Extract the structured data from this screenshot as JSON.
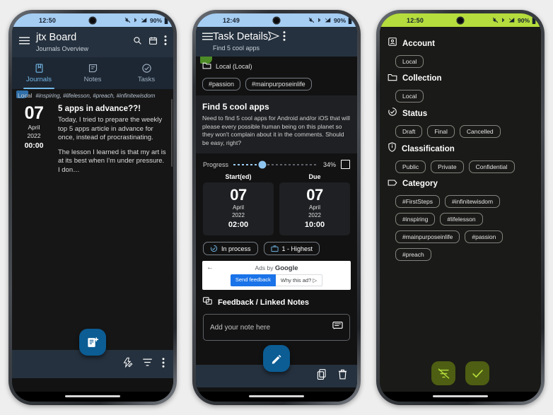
{
  "phone1": {
    "statusbar": {
      "time": "12:50",
      "battery_pct": "90%",
      "icons": [
        "mute-icon",
        "bluetooth-icon",
        "signal-icon",
        "battery-icon"
      ]
    },
    "appbar": {
      "menu_icon": "hamburger-menu-icon",
      "title": "jtx Board",
      "subtitle": "Journals Overview",
      "actions": [
        "search-icon",
        "calendar-icon",
        "overflow-menu-icon"
      ]
    },
    "tabs": [
      {
        "label": "Journals",
        "icon": "journal-icon",
        "active": true
      },
      {
        "label": "Notes",
        "icon": "note-icon",
        "active": false
      },
      {
        "label": "Tasks",
        "icon": "task-check-icon",
        "active": false
      }
    ],
    "entry": {
      "collection": "Local",
      "tags": "#inspiring, #lifelesson, #preach, #infinitewisdom",
      "day": "07",
      "month": "April",
      "year": "2022",
      "time": "00:00",
      "title": "5 apps in advance??!",
      "paragraph1": "Today, I tried to prepare the weekly top 5 apps article in advance for once, instead of procrastinating.",
      "paragraph2": "The lesson I learned is that my art is at its best when I'm under pressure. I don…"
    },
    "fab_icon": "add-note-icon",
    "bottom_actions": [
      "quick-add-icon",
      "filter-icon",
      "overflow-menu-icon"
    ]
  },
  "phone2": {
    "statusbar": {
      "time": "12:49",
      "battery_pct": "90%"
    },
    "appbar": {
      "menu_icon": "hamburger-menu-icon",
      "title": "Task Details",
      "subtitle": "Find 5 cool apps",
      "actions": [
        "send-icon",
        "overflow-menu-icon"
      ]
    },
    "collection": {
      "icon": "folder-icon",
      "label": "Local (Local)"
    },
    "tags": [
      "#passion",
      "#mainpurposeinlife"
    ],
    "card": {
      "title": "Find 5 cool apps",
      "description": "Need to find 5 cool apps for Android and/or iOS that will please every possible human being on this planet so they won't complain about it in the comments. Should be easy, right?"
    },
    "progress": {
      "label": "Progress",
      "percent": "34%",
      "value": 34,
      "checkbox_checked": false
    },
    "dates": [
      {
        "label": "Start(ed)",
        "day": "07",
        "month": "April",
        "year": "2022",
        "time": "02:00"
      },
      {
        "label": "Due",
        "day": "07",
        "month": "April",
        "year": "2022",
        "time": "10:00"
      }
    ],
    "status_chips": [
      {
        "label": "In process",
        "icon": "status-progress-icon"
      },
      {
        "label": "1 - Highest",
        "icon": "priority-icon"
      }
    ],
    "ad": {
      "back_icon": "back-arrow-icon",
      "by": "Ads by ",
      "brand": "Google",
      "btn1": "Send feedback",
      "btn2": "Why this ad? ▷"
    },
    "feedback": {
      "icon": "linked-notes-icon",
      "title": "Feedback / Linked Notes"
    },
    "note_input": {
      "placeholder": "Add your note here",
      "icon": "comment-icon"
    },
    "fab_icon": "edit-pencil-icon",
    "bottom_actions": [
      "copy-icon",
      "delete-icon"
    ]
  },
  "phone3": {
    "statusbar": {
      "time": "12:50",
      "battery_pct": "90%"
    },
    "sections": [
      {
        "title": "Account",
        "icon": "account-icon",
        "chips": [
          "Local"
        ]
      },
      {
        "title": "Collection",
        "icon": "folder-icon",
        "chips": [
          "Local"
        ]
      },
      {
        "title": "Status",
        "icon": "status-progress-icon",
        "chips": [
          "Draft",
          "Final",
          "Cancelled"
        ]
      },
      {
        "title": "Classification",
        "icon": "shield-info-icon",
        "chips": [
          "Public",
          "Private",
          "Confidential"
        ]
      },
      {
        "title": "Category",
        "icon": "tag-icon",
        "chips": [
          "#FirstSteps",
          "#infinitewisdom",
          "#inspiring",
          "#lifelesson",
          "#mainpurposeinlife",
          "#passion",
          "#preach"
        ]
      }
    ],
    "buttons": [
      {
        "name": "clear-filter-button",
        "icon": "filter-off-icon"
      },
      {
        "name": "apply-filter-button",
        "icon": "check-icon"
      }
    ]
  },
  "colors": {
    "statusbar_blue": "#a6cdf2",
    "statusbar_lime": "#b5dd3d",
    "appbar": "#25313e",
    "accent_blue": "#73b7e8",
    "fab_blue": "#0b5d94",
    "green_button": "#4e5e12",
    "green_icon": "#b5dd3d",
    "page_background": "#eeeeee"
  }
}
